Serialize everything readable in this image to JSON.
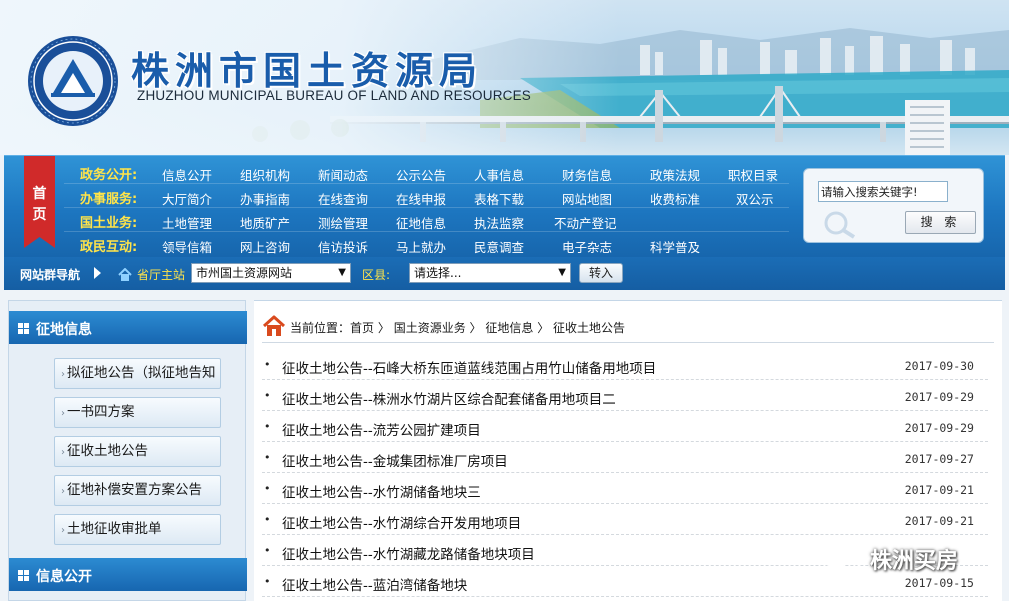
{
  "header": {
    "cn_title": "株洲市国土资源局",
    "en_title": "ZHUZHOU MUNICIPAL BUREAU OF LAND AND RESOURCES",
    "logo_icon": "bureau-emblem-icon"
  },
  "nav": {
    "home_label": "首页",
    "rows": [
      {
        "category": "政务公开:",
        "items": [
          "信息公开",
          "组织机构",
          "新闻动态",
          "公示公告",
          "人事信息",
          "财务信息",
          "政策法规",
          "职权目录"
        ]
      },
      {
        "category": "办事服务:",
        "items": [
          "大厅简介",
          "办事指南",
          "在线查询",
          "在线申报",
          "表格下载",
          "网站地图",
          "收费标准",
          "双公示"
        ]
      },
      {
        "category": "国土业务:",
        "items": [
          "土地管理",
          "地质矿产",
          "测绘管理",
          "征地信息",
          "执法监察",
          "不动产登记"
        ]
      },
      {
        "category": "政民互动:",
        "items": [
          "领导信箱",
          "网上咨询",
          "信访投诉",
          "马上就办",
          "民意调查",
          "电子杂志",
          "科学普及"
        ]
      }
    ],
    "search": {
      "value": "请输入搜索关键字!",
      "button_label": "搜 索"
    }
  },
  "sitenav": {
    "label": "网站群导航",
    "home_label": "省厅主站",
    "site_select": "市州国土资源网站",
    "area_label": "区县:",
    "area_select": "请选择...",
    "go_label": "转入"
  },
  "sidebar": {
    "section1_title": "征地信息",
    "items": [
      "拟征地公告（拟征地告知",
      "一书四方案",
      "征收土地公告",
      "征地补偿安置方案公告",
      "土地征收审批单"
    ],
    "section2_title": "信息公开"
  },
  "breadcrumb": {
    "prefix": "当前位置：",
    "parts": [
      "首页",
      " 〉",
      "国土资源业务",
      " 〉",
      "征地信息",
      " 〉",
      "征收土地公告"
    ]
  },
  "news": [
    {
      "title": "征收土地公告--石峰大桥东匝道蓝线范围占用竹山储备用地项目",
      "date": "2017-09-30"
    },
    {
      "title": "征收土地公告--株洲水竹湖片区综合配套储备用地项目二",
      "date": "2017-09-29"
    },
    {
      "title": "征收土地公告--流芳公园扩建项目",
      "date": "2017-09-29"
    },
    {
      "title": "征收土地公告--金城集团标准厂房项目",
      "date": "2017-09-27"
    },
    {
      "title": "征收土地公告--水竹湖储备地块三",
      "date": "2017-09-21"
    },
    {
      "title": "征收土地公告--水竹湖综合开发用地项目",
      "date": "2017-09-21"
    },
    {
      "title": "征收土地公告--水竹湖藏龙路储备地块项目",
      "date": ""
    },
    {
      "title": "征收土地公告--蓝泊湾储备地块",
      "date": "2017-09-15"
    }
  ],
  "watermark": {
    "text": "株洲买房",
    "icon": "wechat-icon"
  }
}
